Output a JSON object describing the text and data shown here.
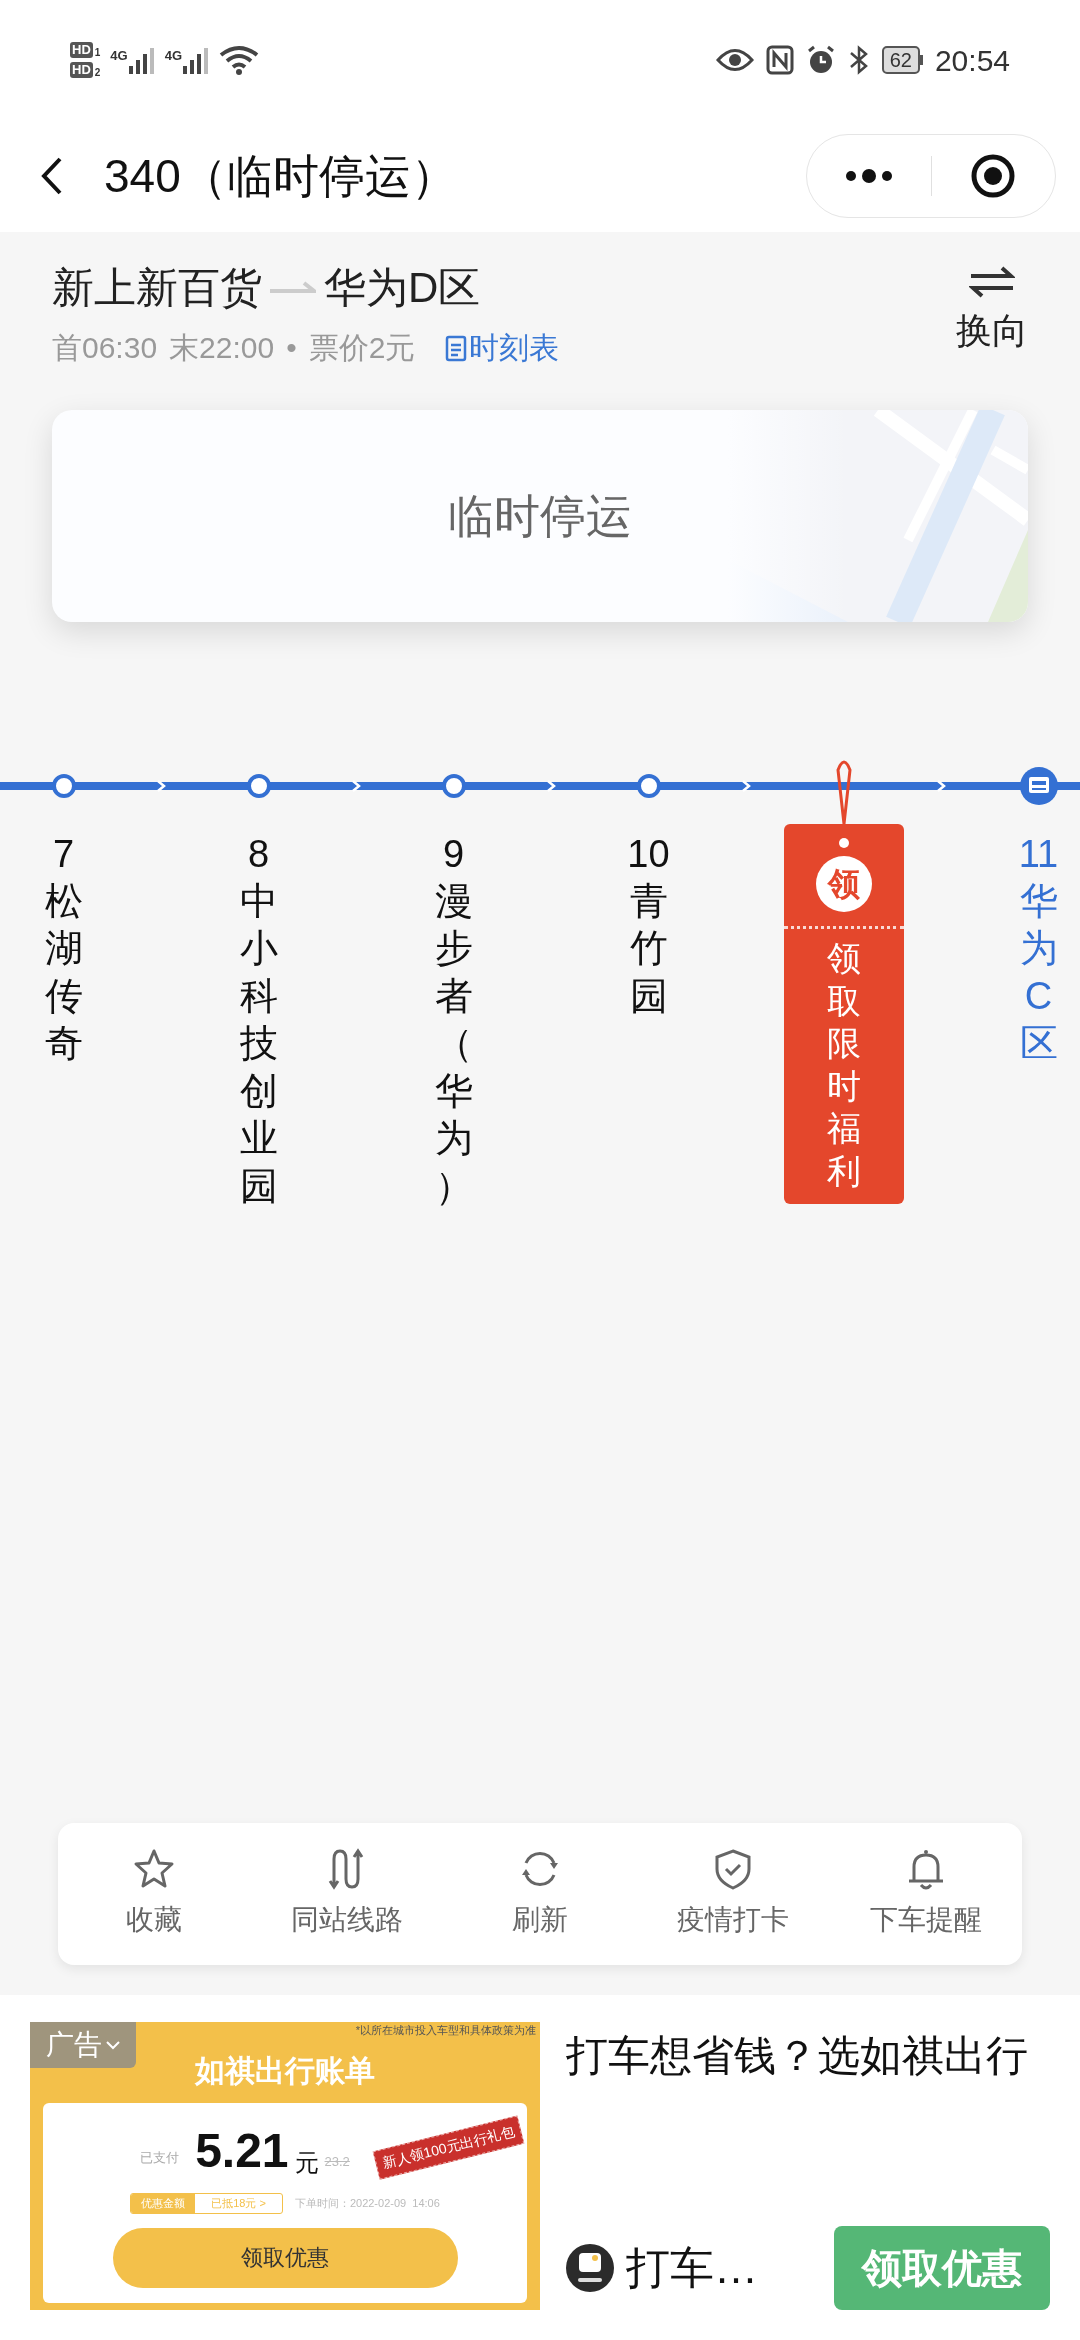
{
  "status_bar": {
    "sims": [
      {
        "label": "HD",
        "slot": "1",
        "network": "4G"
      },
      {
        "label": "HD",
        "slot": "2",
        "network": "4G"
      }
    ],
    "battery": "62",
    "time": "20:54"
  },
  "header": {
    "title": "340（临时停运）"
  },
  "route": {
    "from": "新上新百货",
    "to": "华为D区",
    "first": "首06:30",
    "last": "末22:00",
    "separator": "•",
    "fare": "票价2元",
    "timetable": "时刻表",
    "switch": "换向"
  },
  "notice": {
    "text": "临时停运"
  },
  "stations": [
    {
      "kind": "stop",
      "number": "7",
      "name": "松湖传奇"
    },
    {
      "kind": "stop",
      "number": "8",
      "name": "中小科技创业园"
    },
    {
      "kind": "stop",
      "number": "9",
      "name": "漫步者（华为）"
    },
    {
      "kind": "stop",
      "number": "10",
      "name": "青竹园"
    },
    {
      "kind": "promo",
      "badge": "领",
      "name": "领取限时福利"
    },
    {
      "kind": "current",
      "number": "11",
      "name": "华为C区"
    }
  ],
  "toolbar": [
    {
      "kind": "star",
      "label": "收藏"
    },
    {
      "kind": "route",
      "label": "同站线路"
    },
    {
      "kind": "refresh",
      "label": "刷新"
    },
    {
      "kind": "shield",
      "label": "疫情打卡"
    },
    {
      "kind": "bell",
      "label": "下车提醒"
    }
  ],
  "ad": {
    "tag": "广告",
    "note": "*以所在城市投入车型和具体政策为准",
    "banner_title": "如祺出行账单",
    "paid_label": "已支付",
    "amount": "5.21",
    "unit": "元",
    "original": "23.2",
    "stamp": "新人领100元出行礼包",
    "discount_label": "优惠金额",
    "discount_value": "已抵18元 >",
    "order_time": "下单时间：2022-02-09  14:06",
    "banner_button": "领取优惠",
    "headline": "打车想省钱？选如祺出行",
    "brand": "打车…",
    "button": "领取优惠"
  }
}
